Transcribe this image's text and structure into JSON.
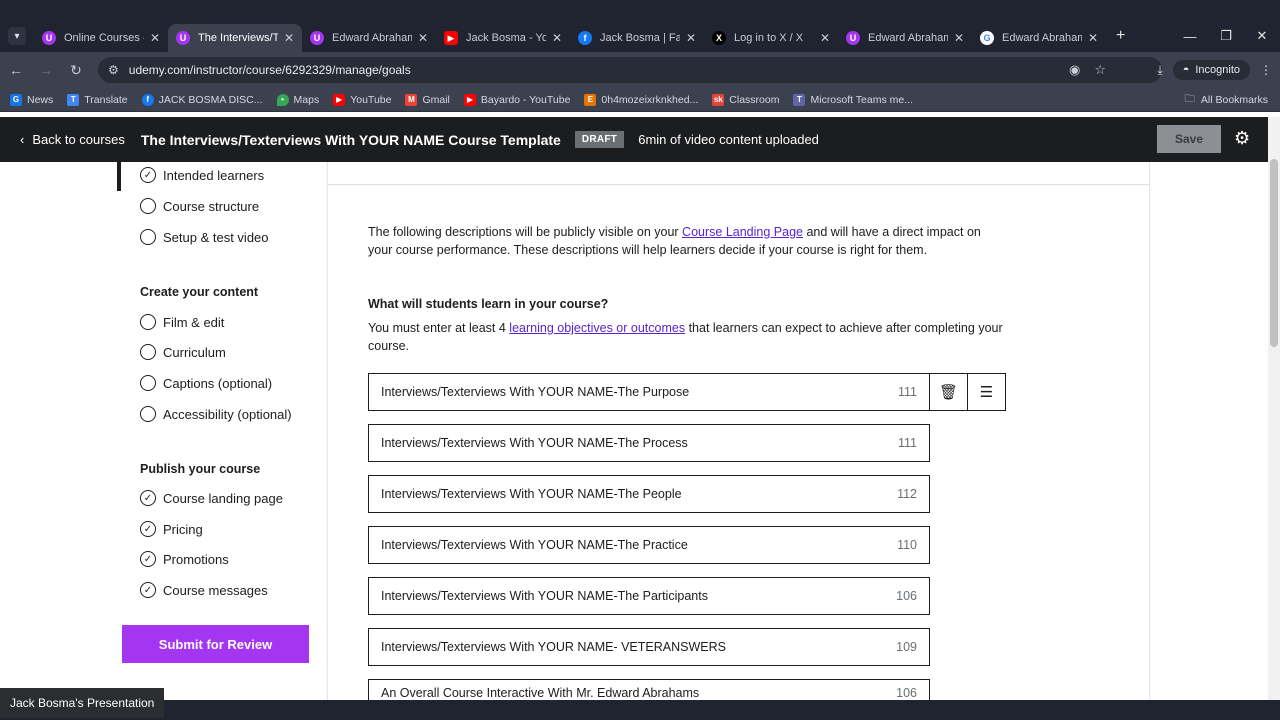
{
  "browser": {
    "tabs": [
      {
        "title": "Online Courses - L",
        "icon": "udemy",
        "color": "#a435f0",
        "active": false
      },
      {
        "title": "The Interviews/Tex",
        "icon": "udemy",
        "color": "#a435f0",
        "active": true
      },
      {
        "title": "Edward Abrahams",
        "icon": "udemy",
        "color": "#a435f0",
        "active": false
      },
      {
        "title": "Jack Bosma - YouT",
        "icon": "youtube",
        "color": "#ff0000",
        "active": false
      },
      {
        "title": "Jack Bosma | Facel",
        "icon": "facebook",
        "color": "#1877f2",
        "active": false
      },
      {
        "title": "Log in to X / X",
        "icon": "x",
        "color": "#000000",
        "active": false
      },
      {
        "title": "Edward Abrahams",
        "icon": "udemy",
        "color": "#a435f0",
        "active": false
      },
      {
        "title": "Edward Abrahams",
        "icon": "google",
        "color": "#4285f4",
        "active": false
      }
    ],
    "url": "udemy.com/instructor/course/6292329/manage/goals",
    "incognito_label": "Incognito",
    "bookmarks": [
      {
        "label": "News",
        "color": "#1a73e8"
      },
      {
        "label": "Translate",
        "color": "#4285f4"
      },
      {
        "label": "JACK BOSMA DISC...",
        "color": "#1877f2"
      },
      {
        "label": "Maps",
        "color": "#34a853"
      },
      {
        "label": "YouTube",
        "color": "#ff0000"
      },
      {
        "label": "Gmail",
        "color": "#ea4335"
      },
      {
        "label": "Bayardo - YouTube",
        "color": "#ff0000"
      },
      {
        "label": "0h4mozeixrknkhed...",
        "color": "#e37400"
      },
      {
        "label": "Classroom",
        "color": "#ea4335"
      },
      {
        "label": "Microsoft Teams me...",
        "color": "#6264a7"
      }
    ],
    "all_bookmarks": "All Bookmarks"
  },
  "header": {
    "back_label": "Back to courses",
    "course_title": "The Interviews/Texterviews With YOUR NAME Course Template",
    "status_badge": "DRAFT",
    "video_info": "6min of video content uploaded",
    "save_label": "Save"
  },
  "sidebar": {
    "plan_items": [
      {
        "label": "Intended learners",
        "checked": true
      },
      {
        "label": "Course structure",
        "checked": false
      },
      {
        "label": "Setup & test video",
        "checked": false
      }
    ],
    "create_heading": "Create your content",
    "create_items": [
      {
        "label": "Film & edit",
        "checked": false
      },
      {
        "label": "Curriculum",
        "checked": false
      },
      {
        "label": "Captions (optional)",
        "checked": false
      },
      {
        "label": "Accessibility (optional)",
        "checked": false
      }
    ],
    "publish_heading": "Publish your course",
    "publish_items": [
      {
        "label": "Course landing page",
        "checked": true
      },
      {
        "label": "Pricing",
        "checked": true
      },
      {
        "label": "Promotions",
        "checked": true
      },
      {
        "label": "Course messages",
        "checked": true
      }
    ],
    "submit_label": "Submit for Review"
  },
  "main": {
    "intro_pre": "The following descriptions will be publicly visible on your ",
    "intro_link": "Course Landing Page",
    "intro_post": " and will have a direct impact on your course performance. These descriptions will help learners decide if your course is right for them.",
    "question_heading": "What will students learn in your course?",
    "question_pre": "You must enter at least 4 ",
    "question_link": "learning objectives or outcomes",
    "question_post": " that learners can expect to achieve after completing your course.",
    "objectives": [
      {
        "text": "Interviews/Texterviews With YOUR NAME-The Purpose",
        "count": "111"
      },
      {
        "text": "Interviews/Texterviews With YOUR NAME-The Process",
        "count": "111"
      },
      {
        "text": "Interviews/Texterviews With YOUR NAME-The People",
        "count": "112"
      },
      {
        "text": "Interviews/Texterviews With YOUR NAME-The Practice",
        "count": "110"
      },
      {
        "text": "Interviews/Texterviews With YOUR NAME-The Participants",
        "count": "106"
      },
      {
        "text": "Interviews/Texterviews With YOUR NAME- VETERANSWERS",
        "count": "109"
      },
      {
        "text": "An Overall Course Interactive With Mr. Edward Abrahams",
        "count": "106"
      }
    ]
  },
  "overlay": {
    "presenter_label": "Jack Bosma's Presentation"
  }
}
